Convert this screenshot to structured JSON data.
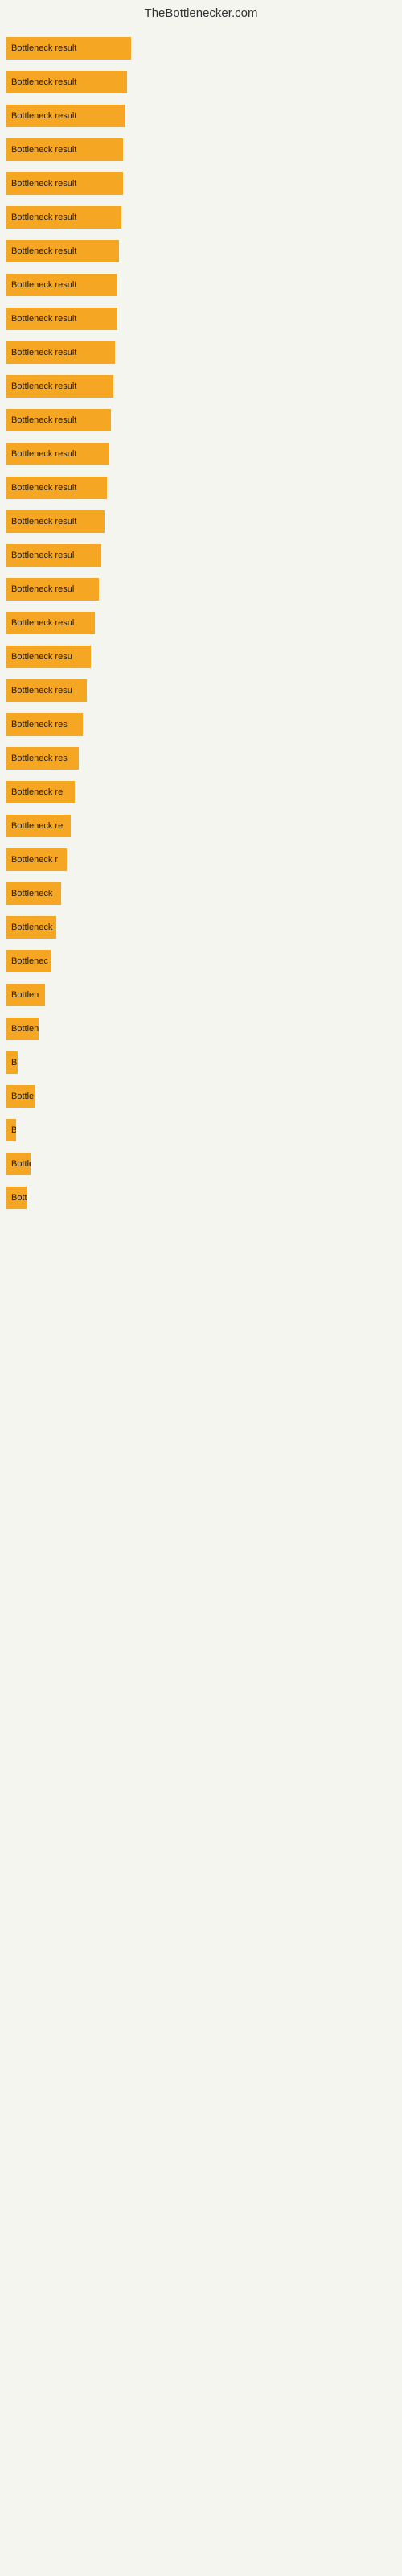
{
  "site": {
    "title": "TheBottlenecker.com"
  },
  "bars": [
    {
      "label": "Bottleneck result",
      "width": 155
    },
    {
      "label": "Bottleneck result",
      "width": 150
    },
    {
      "label": "Bottleneck result",
      "width": 148
    },
    {
      "label": "Bottleneck result",
      "width": 145
    },
    {
      "label": "Bottleneck result",
      "width": 145
    },
    {
      "label": "Bottleneck result",
      "width": 143
    },
    {
      "label": "Bottleneck result",
      "width": 140
    },
    {
      "label": "Bottleneck result",
      "width": 138
    },
    {
      "label": "Bottleneck result",
      "width": 138
    },
    {
      "label": "Bottleneck result",
      "width": 135
    },
    {
      "label": "Bottleneck result",
      "width": 133
    },
    {
      "label": "Bottleneck result",
      "width": 130
    },
    {
      "label": "Bottleneck result",
      "width": 128
    },
    {
      "label": "Bottleneck result",
      "width": 125
    },
    {
      "label": "Bottleneck result",
      "width": 122
    },
    {
      "label": "Bottleneck result",
      "width": 118
    },
    {
      "label": "Bottleneck result",
      "width": 115
    },
    {
      "label": "Bottleneck result",
      "width": 110
    },
    {
      "label": "Bottleneck result",
      "width": 105
    },
    {
      "label": "Bottleneck result",
      "width": 100
    },
    {
      "label": "Bottleneck result",
      "width": 95
    },
    {
      "label": "Bottleneck result",
      "width": 90
    },
    {
      "label": "Bottleneck result",
      "width": 85
    },
    {
      "label": "Bottleneck result",
      "width": 80
    },
    {
      "label": "Bottleneck result",
      "width": 75
    },
    {
      "label": "Bottleneck result",
      "width": 68
    },
    {
      "label": "Bottleneck result",
      "width": 62
    },
    {
      "label": "Bottleneck result",
      "width": 55
    },
    {
      "label": "Bottleneck result",
      "width": 48
    },
    {
      "label": "Bottleneck result",
      "width": 40
    },
    {
      "label": "Bottleneck result",
      "width": 14
    },
    {
      "label": "Bottleneck result",
      "width": 35
    },
    {
      "label": "Bottleneck result",
      "width": 12
    },
    {
      "label": "Bottleneck result",
      "width": 30
    },
    {
      "label": "Bottleneck result",
      "width": 25
    }
  ]
}
